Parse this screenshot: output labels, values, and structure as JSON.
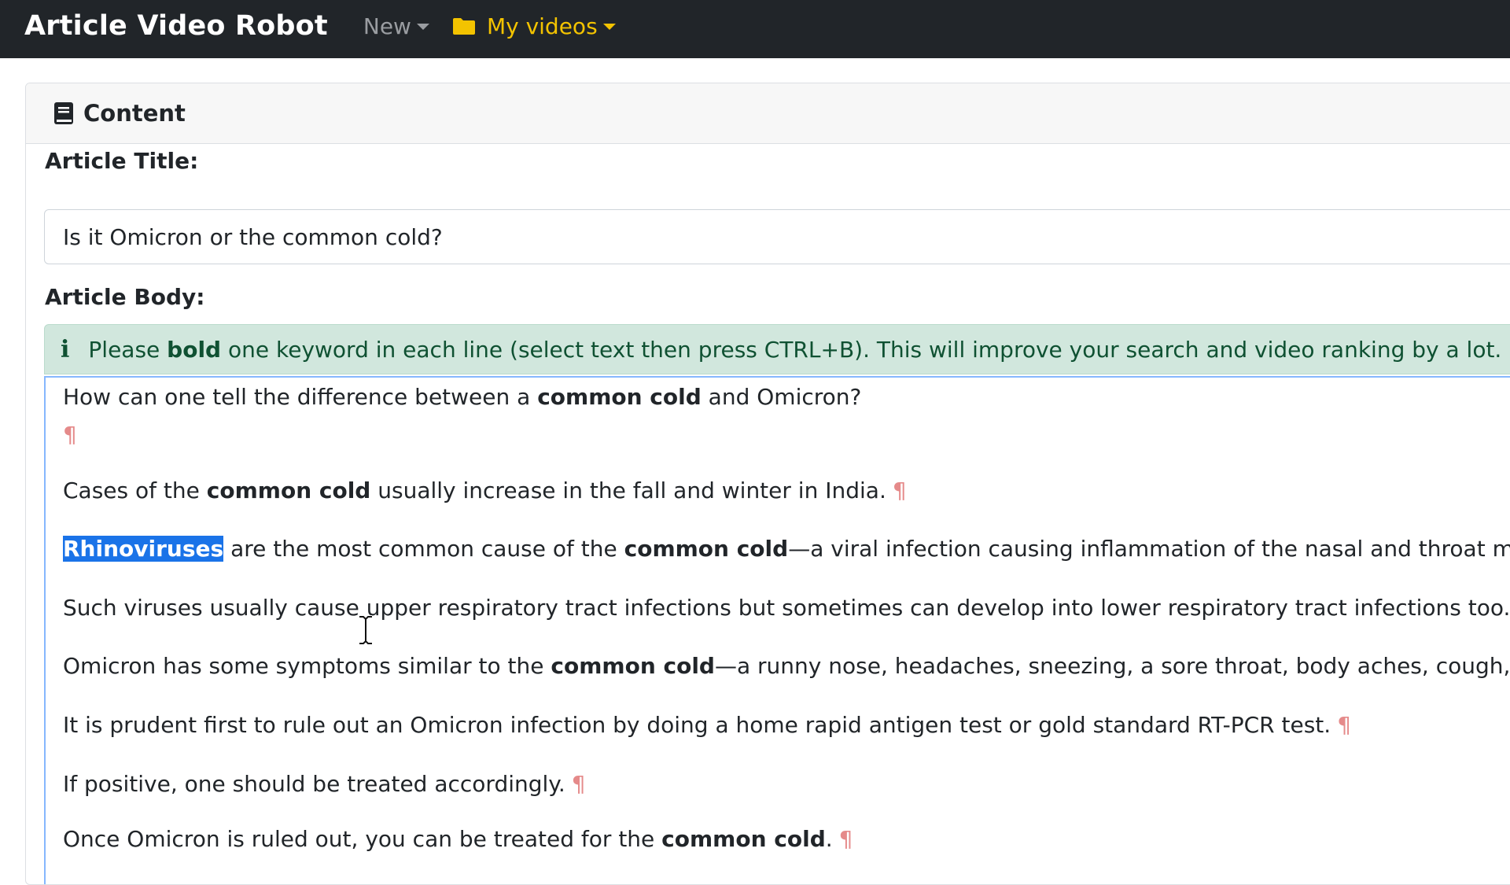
{
  "navbar": {
    "brand": "Article Video Robot",
    "new_label": "New",
    "my_videos_label": "My videos"
  },
  "card": {
    "header_title": "Content",
    "article_title_label": "Article Title:",
    "article_title_value": "Is it Omicron or the common cold?",
    "article_body_label": "Article Body:",
    "alert": {
      "before": "Please ",
      "bold": "bold",
      "after": " one keyword in each line (select text then press CTRL+B). This will improve your search and video ranking by a lot."
    }
  },
  "editor": {
    "pilcrow": "¶",
    "p1": {
      "a": "How can one tell the difference between a ",
      "b": "common cold",
      "c": " and Omicron?"
    },
    "p2": {
      "a": "Cases of the ",
      "b": "common cold",
      "c": " usually increase in the fall and winter in India."
    },
    "p3": {
      "sel": "Rhinoviruses",
      "a": " are the most common cause of the ",
      "b": "common cold",
      "c": "—a viral infection causing inflammation of the nasal and throat mucus me"
    },
    "p4": {
      "a": "Such viruses usually cause upper respiratory tract infections but sometimes can develop into lower respiratory tract infections too."
    },
    "p5": {
      "a": "Omicron has some symptoms similar to the ",
      "b": "common cold",
      "c": "—a runny nose, headaches, sneezing, a sore throat, body aches, cough, fatigue"
    },
    "p6": {
      "a": "It is prudent first to rule out an Omicron infection by doing a home rapid antigen test or gold standard RT-PCR test."
    },
    "p7": {
      "a": "If positive, one should be treated accordingly."
    },
    "p8": {
      "a": "Once Omicron is ruled out, you can be treated for the ",
      "b": "common cold",
      "c": "."
    }
  },
  "colors": {
    "navbar_bg": "#212529",
    "my_videos": "#f3c300",
    "alert_bg": "#d1e7dd",
    "alert_text": "#0f5132",
    "selection": "#1a73e8",
    "pilcrow": "#e58a8a"
  },
  "icons": [
    "folder-icon",
    "book-icon",
    "info-icon",
    "text-cursor-icon"
  ]
}
